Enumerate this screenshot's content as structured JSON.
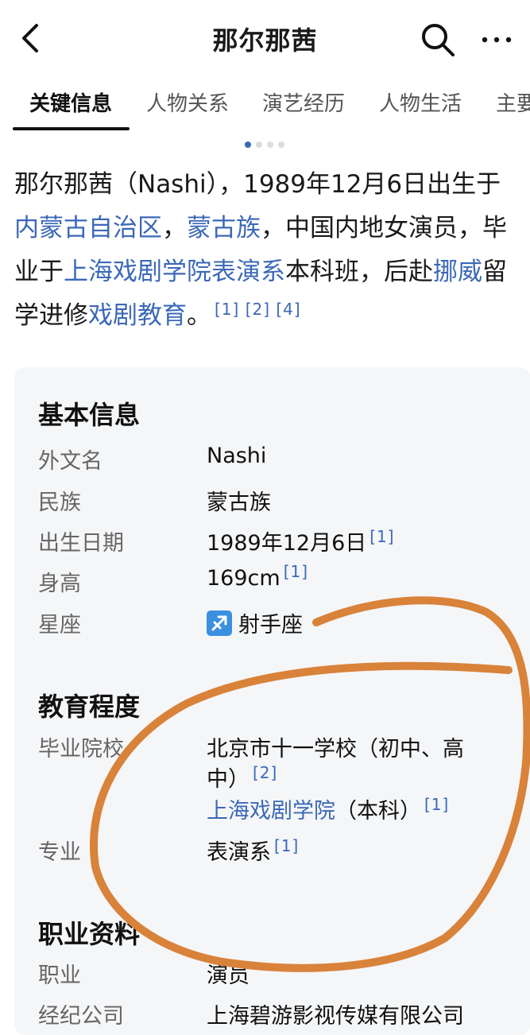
{
  "header": {
    "title": "那尔那茜",
    "back_icon": "back-arrow-icon",
    "search_icon": "search-icon",
    "more_icon": "more-dots-icon"
  },
  "tabs": [
    {
      "label": "关键信息",
      "active": true
    },
    {
      "label": "人物关系",
      "active": false
    },
    {
      "label": "演艺经历",
      "active": false
    },
    {
      "label": "人物生活",
      "active": false
    },
    {
      "label": "主要",
      "active": false
    }
  ],
  "intro": {
    "p1": "那尔那茜（Nashi），1989年12月6日出生于",
    "link_region": "内蒙古自治区",
    "sep1": "，",
    "link_ethnic": "蒙古族",
    "p2": "，中国内地女演员，毕业于",
    "link_school": "上海戏剧学院表演系",
    "p3": "本科班，后赴",
    "link_country": "挪威",
    "p4": "留学进修",
    "link_field": "戏剧教育",
    "p5": "。",
    "refs": "[1] [2] [4]"
  },
  "basic_info": {
    "title": "基本信息",
    "rows": [
      {
        "key": "外文名",
        "value": "Nashi",
        "ref": ""
      },
      {
        "key": "民族",
        "value": "蒙古族",
        "ref": ""
      },
      {
        "key": "出生日期",
        "value": "1989年12月6日",
        "ref": "[1]"
      },
      {
        "key": "身高",
        "value": "169cm",
        "ref": "[1]"
      },
      {
        "key": "星座",
        "value": "射手座",
        "ref": "",
        "icon": "sagittarius-icon"
      }
    ]
  },
  "education": {
    "title": "教育程度",
    "school_key": "毕业院校",
    "school1_line1": "北京市十一学校（初中、高",
    "school1_line2": "中）",
    "school1_ref": "[2]",
    "school2_name": "上海戏剧学院",
    "school2_suffix": "（本科）",
    "school2_ref": "[1]",
    "major_key": "专业",
    "major_value": "表演系",
    "major_ref": "[1]"
  },
  "career": {
    "title": "职业资料",
    "job_key": "职业",
    "job_value": "演员",
    "agency_key": "经纪公司",
    "agency_value": "上海碧游影视传媒有限公司"
  },
  "annotation": {
    "stroke_color": "#d9823a"
  }
}
